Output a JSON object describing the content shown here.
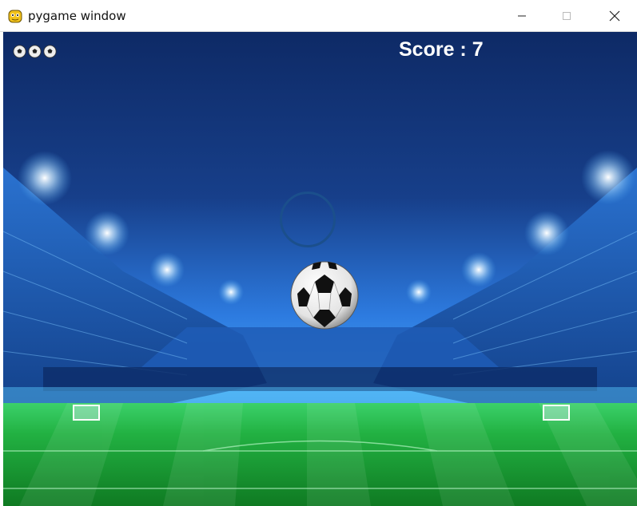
{
  "window": {
    "title": "pygame window",
    "app_icon": "pygame-snake-icon",
    "controls": [
      "minimize-icon",
      "maximize-icon",
      "close-icon"
    ]
  },
  "hud": {
    "score_text": "Score : 7",
    "lives": 3,
    "life_icon": "soccer-ball-icon"
  },
  "scene": {
    "background": "floodlit-soccer-stadium",
    "target": "ring-target",
    "ball": "soccer-ball",
    "colors": {
      "sky_top": "#0e2a66",
      "sky_glow": "#2d7be0",
      "pitch": "#1fa83a",
      "ring": "#1b4f8c",
      "score": "#ffffff"
    }
  }
}
